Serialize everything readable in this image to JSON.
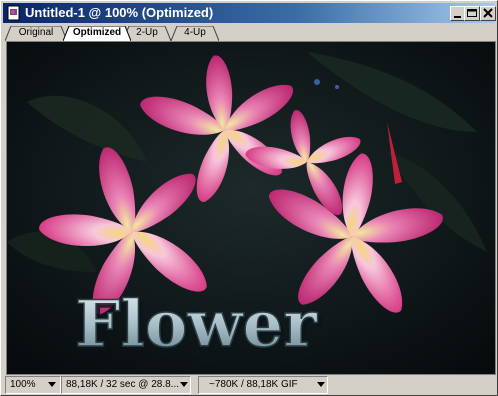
{
  "window": {
    "title": "Untitled-1 @ 100% (Optimized)"
  },
  "titlebar_buttons": {
    "minimize": "minimize-icon",
    "maximize": "maximize-icon",
    "close": "close-icon"
  },
  "tabs": [
    {
      "label": "Original",
      "active": false
    },
    {
      "label": "Optimized",
      "active": true
    },
    {
      "label": "2-Up",
      "active": false
    },
    {
      "label": "4-Up",
      "active": false
    }
  ],
  "image": {
    "overlay_text": "Flower",
    "background_color": "#0e1416",
    "petal_color": "#e0408a",
    "petal_light_color": "#f7c6dc",
    "center_color": "#f5d77a"
  },
  "statusbar": {
    "zoom": "100%",
    "download_info": "88,18K / 32 sec @ 28.8...",
    "size_info": "~780K / 88,18K GIF"
  },
  "colors": {
    "title_gradient_start": "#0a246a",
    "title_gradient_end": "#a6caf0",
    "chrome": "#d4d0c8"
  }
}
